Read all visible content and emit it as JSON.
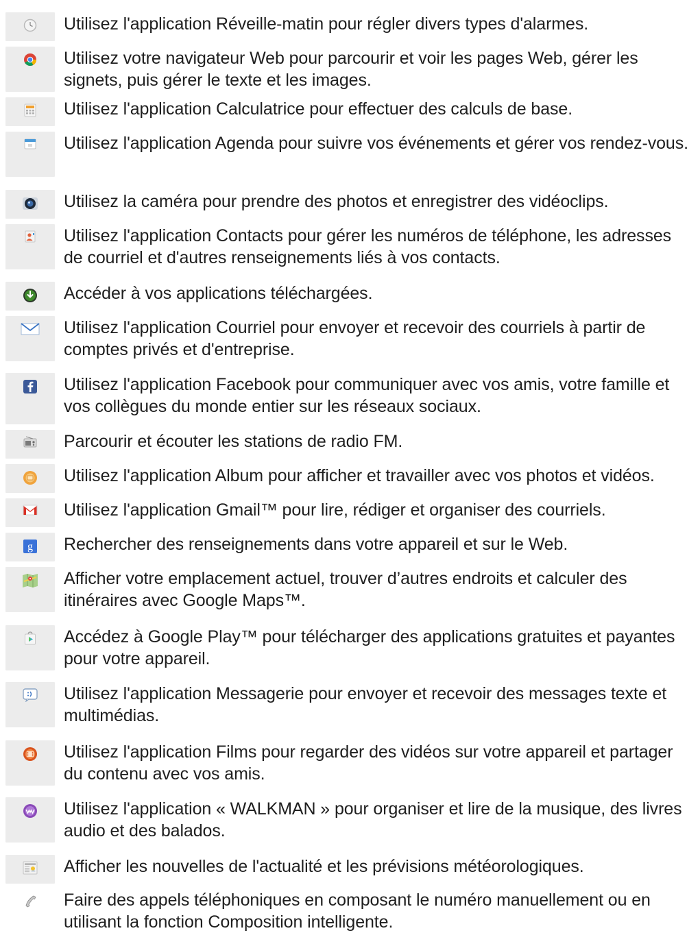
{
  "apps": [
    {
      "icon": "alarm-clock-icon",
      "text": "Utilisez l'application Réveille-matin pour régler divers types d'alarmes."
    },
    {
      "icon": "chrome-browser-icon",
      "text": "Utilisez votre navigateur Web pour parcourir et voir les pages Web, gérer les signets, puis gérer le texte et les images."
    },
    {
      "icon": "calculator-icon",
      "text": "Utilisez l'application Calculatrice pour effectuer des calculs de base."
    },
    {
      "icon": "calendar-icon",
      "text": "Utilisez l'application Agenda pour suivre vos événements et gérer vos rendez-vous."
    },
    {
      "icon": "camera-icon",
      "text": "Utilisez la caméra pour prendre des photos et enregistrer des vidéoclips."
    },
    {
      "icon": "contacts-icon",
      "text": "Utilisez l'application Contacts pour gérer les numéros de téléphone, les adresses de courriel et d'autres renseignements liés à vos contacts."
    },
    {
      "icon": "download-icon",
      "text": "Accéder à vos applications téléchargées."
    },
    {
      "icon": "email-icon",
      "text": "Utilisez l'application Courriel pour envoyer et recevoir des courriels à partir de comptes privés et d'entreprise."
    },
    {
      "icon": "facebook-icon",
      "text": "Utilisez l'application Facebook pour communiquer avec vos amis, votre famille et vos collègues du monde entier sur les réseaux sociaux."
    },
    {
      "icon": "fm-radio-icon",
      "text": "Parcourir et écouter les stations de radio FM."
    },
    {
      "icon": "album-icon",
      "text": "Utilisez l'application Album pour afficher et travailler avec vos photos et vidéos."
    },
    {
      "icon": "gmail-icon",
      "text": "Utilisez l'application Gmail™ pour lire, rédiger et organiser des courriels."
    },
    {
      "icon": "google-search-icon",
      "text": "Rechercher des renseignements dans votre appareil et sur le Web."
    },
    {
      "icon": "maps-icon",
      "text": "Afficher votre emplacement actuel, trouver d’autres endroits et calculer des itinéraires avec Google Maps™."
    },
    {
      "icon": "play-store-icon",
      "text": "Accédez à Google Play™ pour télécharger des applications gratuites et payantes pour votre appareil."
    },
    {
      "icon": "messaging-icon",
      "text": "Utilisez l'application Messagerie pour envoyer et recevoir des messages texte et multimédias."
    },
    {
      "icon": "movies-icon",
      "text": "Utilisez l'application Films pour regarder des vidéos sur votre appareil et partager du contenu avec vos amis."
    },
    {
      "icon": "walkman-icon",
      "text": "Utilisez l'application « WALKMAN » pour organiser et lire de la musique, des livres audio et des balados."
    },
    {
      "icon": "news-weather-icon",
      "text": "Afficher les nouvelles de l'actualité et les prévisions météorologiques."
    },
    {
      "icon": "phone-icon",
      "text": "Faire des appels téléphoniques en composant le numéro manuellement ou en utilisant la fonction Composition intelligente."
    }
  ]
}
